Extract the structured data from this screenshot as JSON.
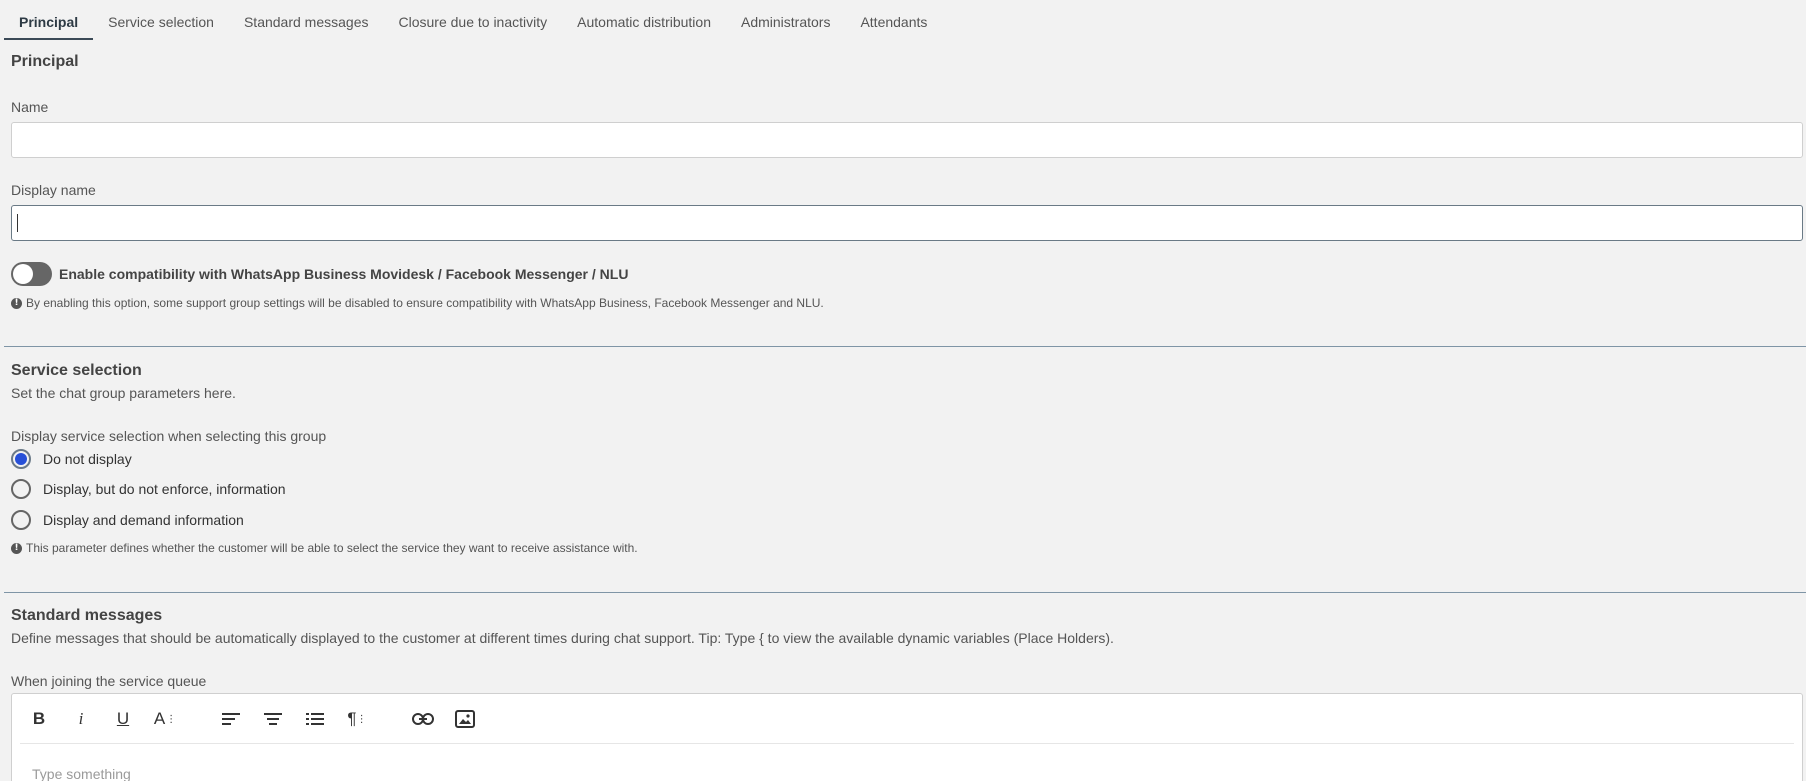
{
  "tabs": [
    {
      "label": "Principal",
      "active": true
    },
    {
      "label": "Service selection",
      "active": false
    },
    {
      "label": "Standard messages",
      "active": false
    },
    {
      "label": "Closure due to inactivity",
      "active": false
    },
    {
      "label": "Automatic distribution",
      "active": false
    },
    {
      "label": "Administrators",
      "active": false
    },
    {
      "label": "Attendants",
      "active": false
    }
  ],
  "principal": {
    "title": "Principal",
    "name_label": "Name",
    "name_value": "",
    "display_name_label": "Display name",
    "display_name_value": "",
    "compat_toggle_label": "Enable compatibility with WhatsApp Business Movidesk / Facebook Messenger / NLU",
    "compat_toggle_on": false,
    "compat_info": "By enabling this option, some support group settings will be disabled to ensure compatibility with WhatsApp Business, Facebook Messenger and NLU."
  },
  "service_selection": {
    "title": "Service selection",
    "subtitle": "Set the chat group parameters here.",
    "question": "Display service selection when selecting this group",
    "options": [
      {
        "label": "Do not display",
        "checked": true
      },
      {
        "label": "Display, but do not enforce, information",
        "checked": false
      },
      {
        "label": "Display and demand information",
        "checked": false
      }
    ],
    "info": "This parameter defines whether the customer will be able to select the service they want to receive assistance with."
  },
  "standard_messages": {
    "title": "Standard messages",
    "subtitle": "Define messages that should be automatically displayed to the customer at different times during chat support. Tip: Type { to view the available dynamic variables (Place Holders).",
    "queue_label": "When joining the service queue",
    "editor_placeholder": "Type something",
    "toolbar_icons": [
      "bold-icon",
      "italic-icon",
      "underline-icon",
      "font-size-icon",
      "align-left-icon",
      "align-center-icon",
      "ordered-list-icon",
      "paragraph-icon",
      "link-icon",
      "image-icon"
    ],
    "toolbar_glyphs": {
      "bold": "B",
      "italic": "i",
      "underline": "U",
      "font_size": "A"
    }
  },
  "colors": {
    "background": "#f2f2f2",
    "divider": "#7f95a6",
    "radio_checked": "#2750d8",
    "toggle_off": "#666666"
  }
}
